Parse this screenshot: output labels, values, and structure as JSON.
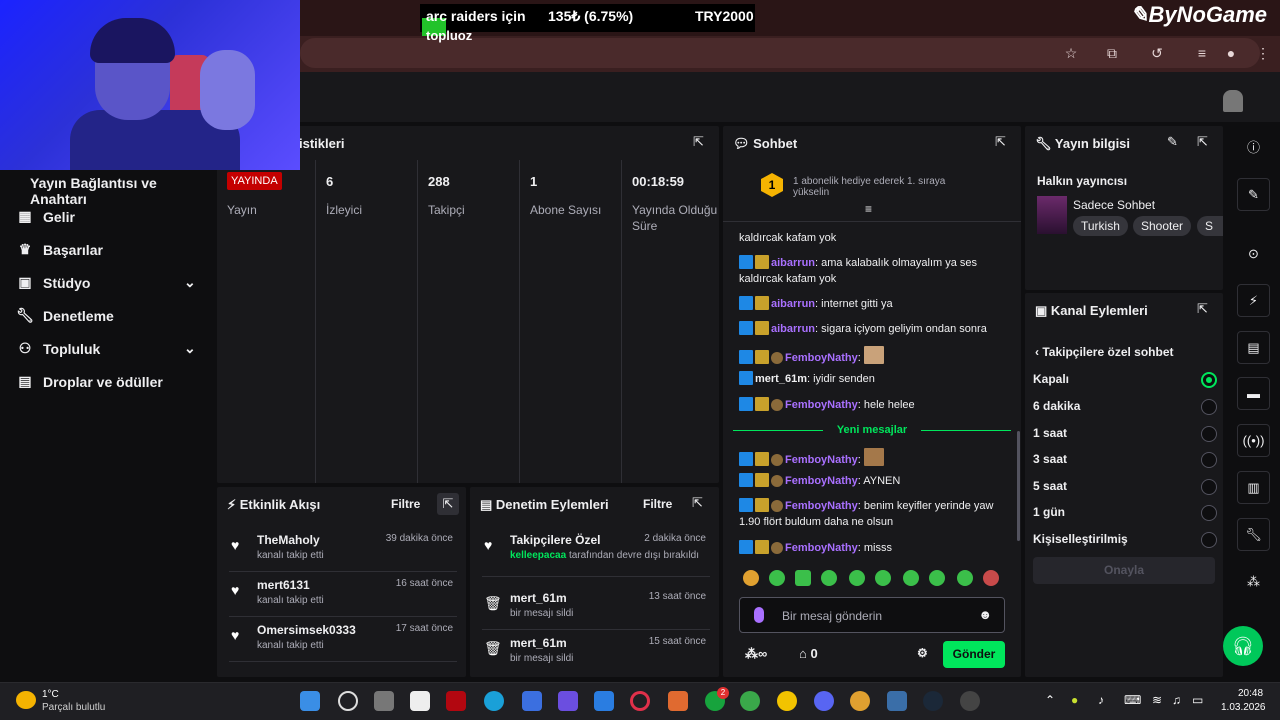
{
  "ticker": {
    "item": "arc raiders için",
    "item2": "topluoz",
    "price": "135₺ (6.75%)",
    "goal": "TRY2000"
  },
  "brand_logo": "ByNoGame",
  "nav": {
    "section_title": "Yayın Bağlantısı ve Anahtarı",
    "items": [
      {
        "label": "Gelir",
        "icon": "money-icon"
      },
      {
        "label": "Başarılar",
        "icon": "trophy-icon"
      },
      {
        "label": "Stüdyo",
        "icon": "studio-icon",
        "expandable": true
      },
      {
        "label": "Denetleme",
        "icon": "wrench-icon"
      },
      {
        "label": "Topluluk",
        "icon": "people-icon",
        "expandable": true
      },
      {
        "label": "Droplar ve ödüller",
        "icon": "gift-icon"
      }
    ]
  },
  "stats": {
    "title_fragment": "istikleri",
    "live_badge": "YAYINDA",
    "live_label": "Yayın",
    "columns": [
      {
        "value": "6",
        "label": "İzleyici"
      },
      {
        "value": "288",
        "label": "Takipçi"
      },
      {
        "value": "1",
        "label": "Abone Sayısı"
      },
      {
        "value": "00:18:59",
        "label": "Yayında Olduğu Süre"
      }
    ]
  },
  "activity": {
    "title": "Etkinlik Akışı",
    "filter": "Filtre",
    "items": [
      {
        "name": "TheMaholy",
        "action": "kanalı takip etti",
        "time": "39 dakika önce"
      },
      {
        "name": "mert6131",
        "action": "kanalı takip etti",
        "time": "16 saat önce"
      },
      {
        "name": "Omersimsek0333",
        "action": "kanalı takip etti",
        "time": "17 saat önce"
      }
    ]
  },
  "moderation": {
    "title": "Denetim Eylemleri",
    "filter": "Filtre",
    "items": [
      {
        "name": "Takipçilere Özel",
        "actor": "kelleepacaa",
        "action": "tarafından devre dışı bırakıldı",
        "time": "2 dakika önce"
      },
      {
        "name": "mert_61m",
        "action": "bir mesajı sildi",
        "time": "13 saat önce"
      },
      {
        "name": "mert_61m",
        "action": "bir mesajı sildi",
        "time": "15 saat önce"
      }
    ]
  },
  "chat": {
    "title": "Sohbet",
    "banner_rank": "1",
    "banner": "1 abonelik hediye ederek 1. sıraya yükselin",
    "messages": [
      {
        "user": "",
        "text": "kaldırcak kafam yok"
      },
      {
        "user": "aibarrun",
        "text": ": ama kalabalık olmayalım ya ses kaldırcak kafam yok"
      },
      {
        "user": "aibarrun",
        "text": ": internet gitti ya"
      },
      {
        "user": "aibarrun",
        "text": ": sigara içiyom geliyim ondan sonra"
      },
      {
        "user": "FemboyNathy",
        "text": ":"
      },
      {
        "user": "mert_61m",
        "text": ": iyidir senden"
      },
      {
        "user": "FemboyNathy",
        "text": ": hele helee"
      }
    ],
    "new_messages_label": "Yeni mesajlar",
    "new_messages": [
      {
        "user": "FemboyNathy",
        "text": ":"
      },
      {
        "user": "FemboyNathy",
        "text": ": AYNEN"
      },
      {
        "user": "FemboyNathy",
        "text": ": benim keyifler yerinde yaw 1.90 flört buldum daha ne olsun"
      },
      {
        "user": "FemboyNathy",
        "text": ": misss"
      }
    ],
    "input_placeholder": "Bir mesaj gönderin",
    "send": "Gönder",
    "points": "∞",
    "channel_points": "0"
  },
  "stream_info": {
    "title": "Yayın bilgisi",
    "streamer": "Halkın yayıncısı",
    "category": "Sadece Sohbet",
    "tags": [
      "Turkish",
      "Shooter",
      "S"
    ]
  },
  "channel_actions": {
    "title": "Kanal Eylemleri",
    "subtitle": "Takipçilere özel sohbet",
    "options": [
      {
        "label": "Kapalı",
        "selected": true
      },
      {
        "label": "6 dakika",
        "selected": false
      },
      {
        "label": "1 saat",
        "selected": false
      },
      {
        "label": "3 saat",
        "selected": false
      },
      {
        "label": "5 saat",
        "selected": false
      },
      {
        "label": "1 gün",
        "selected": false
      },
      {
        "label": "Kişiselleştirilmiş",
        "selected": false
      }
    ],
    "apply": "Onayla"
  },
  "taskbar": {
    "temp": "1°C",
    "condition": "Parçalı bulutlu",
    "time": "20:48",
    "date": "1.03.2026",
    "badge_count": "2"
  },
  "colors": {
    "accent": "#00e65c",
    "purple": "#a970ff",
    "live": "#c40000"
  }
}
